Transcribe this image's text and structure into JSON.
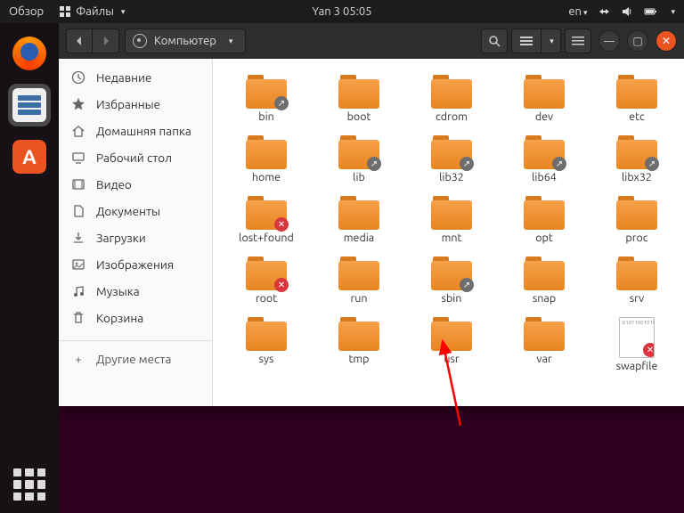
{
  "menubar": {
    "activities": "Обзор",
    "files_label": "Файлы",
    "datetime": "Yan 3  05:05",
    "lang": "en"
  },
  "titlebar": {
    "location": "Компьютер"
  },
  "sidebar": {
    "items": [
      {
        "icon": "recent",
        "label": "Недавние"
      },
      {
        "icon": "star",
        "label": "Избранные"
      },
      {
        "icon": "home",
        "label": "Домашняя папка"
      },
      {
        "icon": "desktop",
        "label": "Рабочий стол"
      },
      {
        "icon": "video",
        "label": "Видео"
      },
      {
        "icon": "documents",
        "label": "Документы"
      },
      {
        "icon": "downloads",
        "label": "Загрузки"
      },
      {
        "icon": "pictures",
        "label": "Изображения"
      },
      {
        "icon": "music",
        "label": "Музыка"
      },
      {
        "icon": "trash",
        "label": "Корзина"
      }
    ],
    "other_places": "Другие места"
  },
  "files": [
    {
      "name": "bin",
      "type": "folder",
      "badge": "link"
    },
    {
      "name": "boot",
      "type": "folder"
    },
    {
      "name": "cdrom",
      "type": "folder"
    },
    {
      "name": "dev",
      "type": "folder"
    },
    {
      "name": "etc",
      "type": "folder"
    },
    {
      "name": "home",
      "type": "folder"
    },
    {
      "name": "lib",
      "type": "folder",
      "badge": "link"
    },
    {
      "name": "lib32",
      "type": "folder",
      "badge": "link"
    },
    {
      "name": "lib64",
      "type": "folder",
      "badge": "link"
    },
    {
      "name": "libx32",
      "type": "folder",
      "badge": "link"
    },
    {
      "name": "lost+found",
      "type": "folder",
      "badge": "denied"
    },
    {
      "name": "media",
      "type": "folder"
    },
    {
      "name": "mnt",
      "type": "folder"
    },
    {
      "name": "opt",
      "type": "folder"
    },
    {
      "name": "proc",
      "type": "folder"
    },
    {
      "name": "root",
      "type": "folder",
      "badge": "denied"
    },
    {
      "name": "run",
      "type": "folder"
    },
    {
      "name": "sbin",
      "type": "folder",
      "badge": "link"
    },
    {
      "name": "snap",
      "type": "folder"
    },
    {
      "name": "srv",
      "type": "folder"
    },
    {
      "name": "sys",
      "type": "folder"
    },
    {
      "name": "tmp",
      "type": "folder"
    },
    {
      "name": "usr",
      "type": "folder"
    },
    {
      "name": "var",
      "type": "folder"
    },
    {
      "name": "swapfile",
      "type": "file",
      "badge": "denied"
    }
  ]
}
